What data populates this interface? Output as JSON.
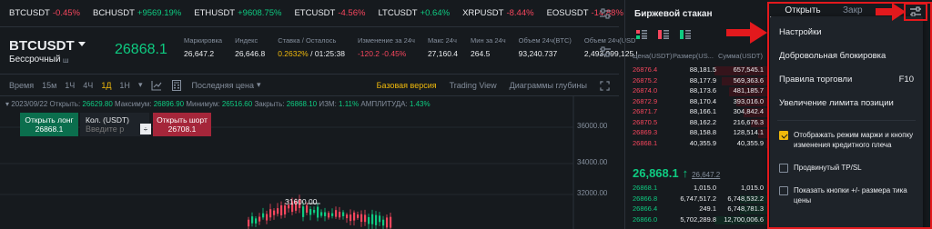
{
  "ticker_bar": {
    "items": [
      {
        "symbol": "BTCUSDT",
        "change": "-0.45%",
        "dir": "down"
      },
      {
        "symbol": "BCHUSDT",
        "change": "+9569.19%",
        "dir": "up"
      },
      {
        "symbol": "ETHUSDT",
        "change": "+9608.75%",
        "dir": "up"
      },
      {
        "symbol": "ETCUSDT",
        "change": "-4.56%",
        "dir": "down"
      },
      {
        "symbol": "LTCUSDT",
        "change": "+0.64%",
        "dir": "up"
      },
      {
        "symbol": "XRPUSDT",
        "change": "-8.44%",
        "dir": "down"
      },
      {
        "symbol": "EOSUSDT",
        "change": "-14.88%",
        "dir": "down"
      }
    ]
  },
  "symbol": {
    "name": "BTCUSDT",
    "contract": "Бессрочный",
    "contract_icon": "ш",
    "last_price": "26868.1"
  },
  "stats": [
    {
      "label": "Маркировка",
      "value": "26,647.2",
      "style": ""
    },
    {
      "label": "Индекс",
      "value": "26,646.8",
      "style": ""
    },
    {
      "label": "Ставка / Осталось",
      "value": "0.2632%",
      "value2": "01:25:38",
      "style": "orange"
    },
    {
      "label": "Изменение за 24ч",
      "value": "-120.2",
      "value2": "-0.45%",
      "style": "red"
    },
    {
      "label": "Макс 24ч",
      "value": "27,160.4",
      "style": ""
    },
    {
      "label": "Мин за 24ч",
      "value": "264.5",
      "style": ""
    },
    {
      "label": "Объем 24ч(BTC)",
      "value": "93,240.737",
      "style": ""
    },
    {
      "label": "Объем 24ч(USDT)",
      "value": "2,493,999,125.9",
      "style": ""
    }
  ],
  "chart_toolbar": {
    "intervals": [
      "Время",
      "15м",
      "1Ч",
      "4Ч",
      "1Д",
      "1Н"
    ],
    "active_interval": "1Д",
    "interval_more": "▾",
    "price_type": "Последняя цена",
    "price_type_caret": "▾",
    "views": [
      "Базовая версия",
      "Trading View",
      "Диаграммы глубины"
    ],
    "active_view": "Базовая версия"
  },
  "ohlc": {
    "date": "2023/09/22",
    "open_label": "Открыть:",
    "open": "26629.80",
    "high_label": "Максимум:",
    "high": "26896.90",
    "low_label": "Минимум:",
    "low": "26516.60",
    "close_label": "Закрыть:",
    "close": "26868.10",
    "change_label": "ИЗМ:",
    "change": "1.11%",
    "amp_label": "АМПЛИТУДА:",
    "amp": "1.43%"
  },
  "trade_widget": {
    "long_label": "Открыть лонг",
    "long_price": "26868.1",
    "qty_label": "Кол. (USDT)",
    "qty_placeholder": "Введите р",
    "stepper": "÷",
    "short_label": "Открыть шорт",
    "short_price": "26708.1"
  },
  "axis": {
    "ticks": [
      "36000.00",
      "34000.00",
      "32000.00"
    ],
    "peak_label": "31600.00"
  },
  "orderbook": {
    "title": "Биржевой стакан",
    "headers": [
      "Цена(USDT)",
      "Размер(US...",
      "Сумма(USDT)"
    ],
    "asks": [
      {
        "price": "26876.4",
        "size": "88,181.5",
        "total": "657,545.1"
      },
      {
        "price": "26875.2",
        "size": "88,177.9",
        "total": "569,363.6"
      },
      {
        "price": "26874.0",
        "size": "88,173.6",
        "total": "481,185.7"
      },
      {
        "price": "26872.9",
        "size": "88,170.4",
        "total": "393,016.0"
      },
      {
        "price": "26871.7",
        "size": "88,166.1",
        "total": "304,842.4"
      },
      {
        "price": "26870.5",
        "size": "88,162.2",
        "total": "216,676.3"
      },
      {
        "price": "26869.3",
        "size": "88,158.8",
        "total": "128,514.1"
      },
      {
        "price": "26868.1",
        "size": "40,355.9",
        "total": "40,355.9"
      }
    ],
    "mid_price": "26,868.1",
    "mid_arrow": "↑",
    "mark_price": "26,647.2",
    "bids": [
      {
        "price": "26868.1",
        "size": "1,015.0",
        "total": "1,015.0"
      },
      {
        "price": "26866.8",
        "size": "6,747,517.2",
        "total": "6,748,532.2"
      },
      {
        "price": "26866.4",
        "size": "249.1",
        "total": "6,748,781.3"
      },
      {
        "price": "26866.0",
        "size": "5,702,289.8",
        "total": "12,700,006.6"
      }
    ]
  },
  "panel_tabs": {
    "open": "Открыть",
    "close_partial": "Закр"
  },
  "settings_menu": {
    "items": [
      {
        "label": "Настройки",
        "shortcut": ""
      },
      {
        "label": "Добровольная блокировка",
        "shortcut": ""
      },
      {
        "label": "Правила торговли",
        "shortcut": "F10"
      },
      {
        "label": "Увеличение лимита позиции",
        "shortcut": ""
      }
    ],
    "checks": [
      {
        "label": "Отображать режим маржи и кнопку изменения кредитного плеча",
        "checked": true
      },
      {
        "label": "Продвинутый TP/SL",
        "checked": false
      },
      {
        "label": "Показать кнопки +/- размера тика цены",
        "checked": false
      }
    ]
  },
  "colors": {
    "up": "#0ecb81",
    "down": "#f6465d",
    "accent": "#f0b90b",
    "background": "#161a1e",
    "annotation": "#e3191d"
  }
}
